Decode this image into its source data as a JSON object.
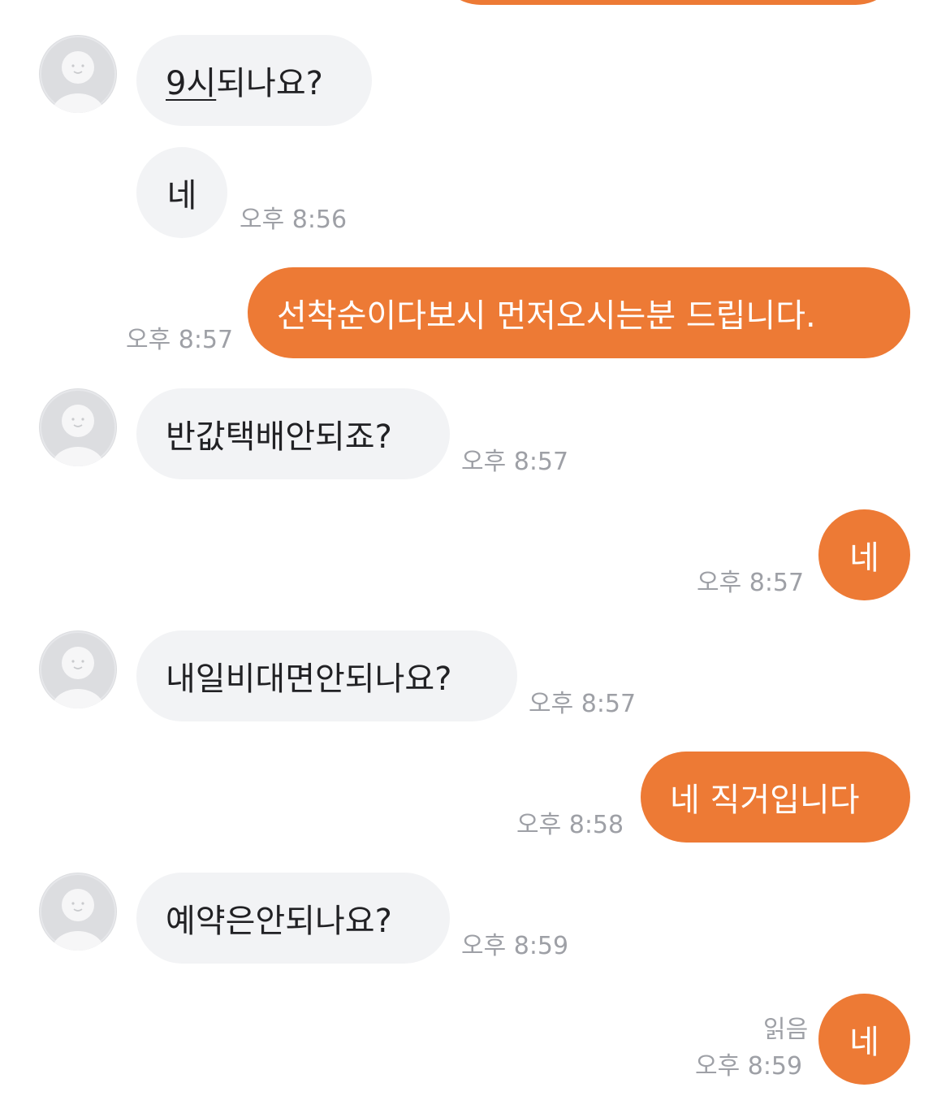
{
  "colors": {
    "outgoing_bubble": "#ed7a35",
    "incoming_bubble": "#f2f3f5",
    "timestamp": "#9ea0a6"
  },
  "messages": [
    {
      "from": "them",
      "text_link": "9시",
      "text_rest": "되나요?"
    },
    {
      "from": "them",
      "text": "네",
      "time": "오후 8:56"
    },
    {
      "from": "me",
      "text": "선착순이다보시 먼저오시는분 드립니다.",
      "time": "오후 8:57"
    },
    {
      "from": "them",
      "text": "반값택배안되죠?",
      "time": "오후 8:57"
    },
    {
      "from": "me",
      "text": "네",
      "time": "오후 8:57"
    },
    {
      "from": "them",
      "text": "내일비대면안되나요?",
      "time": "오후 8:57"
    },
    {
      "from": "me",
      "text": "네 직거입니다",
      "time": "오후 8:58"
    },
    {
      "from": "them",
      "text": "예약은안되나요?",
      "time": "오후 8:59"
    },
    {
      "from": "me",
      "text": "네",
      "time": "오후 8:59",
      "read_status": "읽음"
    }
  ],
  "icons": {
    "avatar": "default-user-avatar-icon"
  }
}
